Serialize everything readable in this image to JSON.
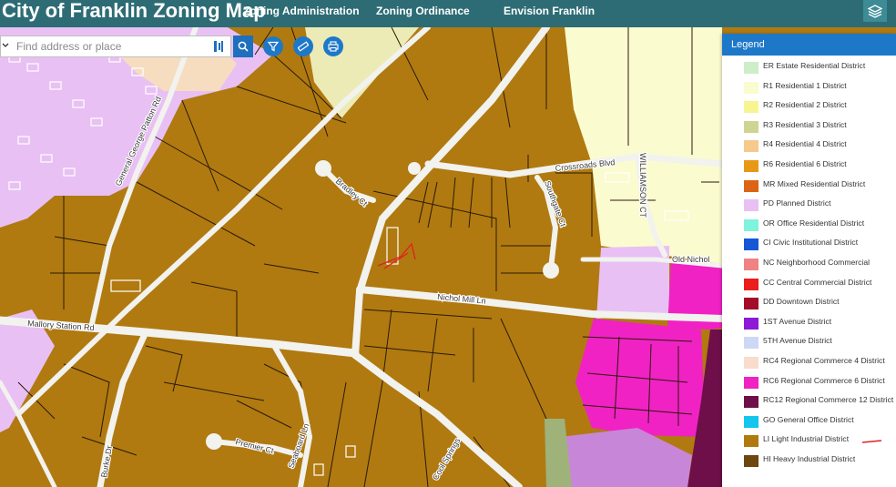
{
  "header": {
    "title": "City of Franklin Zoning Map",
    "nav": [
      {
        "label": "Zoning Administration"
      },
      {
        "label": "Zoning Ordinance"
      },
      {
        "label": "Envision Franklin"
      }
    ],
    "layers_icon": "layers-icon"
  },
  "search": {
    "placeholder": "Find address or place",
    "value": "",
    "icons": [
      "chevron-icon",
      "locate-icon",
      "search-icon"
    ]
  },
  "tools": [
    {
      "name": "filter",
      "icon": "filter-icon"
    },
    {
      "name": "measure",
      "icon": "ruler-icon"
    },
    {
      "name": "print",
      "icon": "printer-icon"
    }
  ],
  "legend": {
    "title": "Legend",
    "items": [
      {
        "label": "ER Estate Residential District",
        "color": "#cdeec8"
      },
      {
        "label": "R1 Residential 1 District",
        "color": "#fbfbd0"
      },
      {
        "label": "R2 Residential 2 District",
        "color": "#f7f592"
      },
      {
        "label": "R3 Residential 3 District",
        "color": "#cfd493"
      },
      {
        "label": "R4 Residential 4 District",
        "color": "#f6c98d"
      },
      {
        "label": "R6 Residential 6 District",
        "color": "#e89817"
      },
      {
        "label": "MR Mixed Residential District",
        "color": "#dc6515"
      },
      {
        "label": "PD Planned District",
        "color": "#e8c0f4"
      },
      {
        "label": "OR Office Residential District",
        "color": "#7ef4dc"
      },
      {
        "label": "CI Civic Institutional District",
        "color": "#1558d6"
      },
      {
        "label": "NC Neighborhood Commercial",
        "color": "#f08282"
      },
      {
        "label": "CC Central Commercial District",
        "color": "#ea1c1c"
      },
      {
        "label": "DD Downtown District",
        "color": "#a40d2a"
      },
      {
        "label": "1ST Avenue District",
        "color": "#8d1ad6"
      },
      {
        "label": "5TH Avenue District",
        "color": "#ccd8f4"
      },
      {
        "label": "RC4 Regional Commerce 4 District",
        "color": "#f9dccb"
      },
      {
        "label": "RC6 Regional Commerce 6 District",
        "color": "#f022c4"
      },
      {
        "label": "RC12 Regional Commerce 12 District",
        "color": "#6e0f4a"
      },
      {
        "label": "GO General Office District",
        "color": "#14c5ee"
      },
      {
        "label": "LI Light Industrial District",
        "color": "#b07a10"
      },
      {
        "label": "HI Heavy Industrial District",
        "color": "#6e4610"
      }
    ]
  },
  "map": {
    "street_labels": [
      "Mallory Station Rd",
      "Nichol Mill Ln",
      "Crossroads Blvd",
      "Southgate Ct",
      "Bradley Ct",
      "General George Patton Rd",
      "WILLIAMSON CT",
      "Old Nichol",
      "Premier Ct",
      "Seaboard Ln",
      "Burke Dr",
      "Cool Springs"
    ],
    "colors": {
      "industrial": "#b07a10",
      "planned": "#e8c0f4",
      "residential1": "#fbfbd0",
      "residential2": "#f7f592",
      "regional_commerce6": "#f022c4",
      "regional_commerce12": "#6e0f4a",
      "road": "#f2f2ee",
      "parcel_line": "#2a1a08",
      "annotation": "#e02020"
    }
  }
}
